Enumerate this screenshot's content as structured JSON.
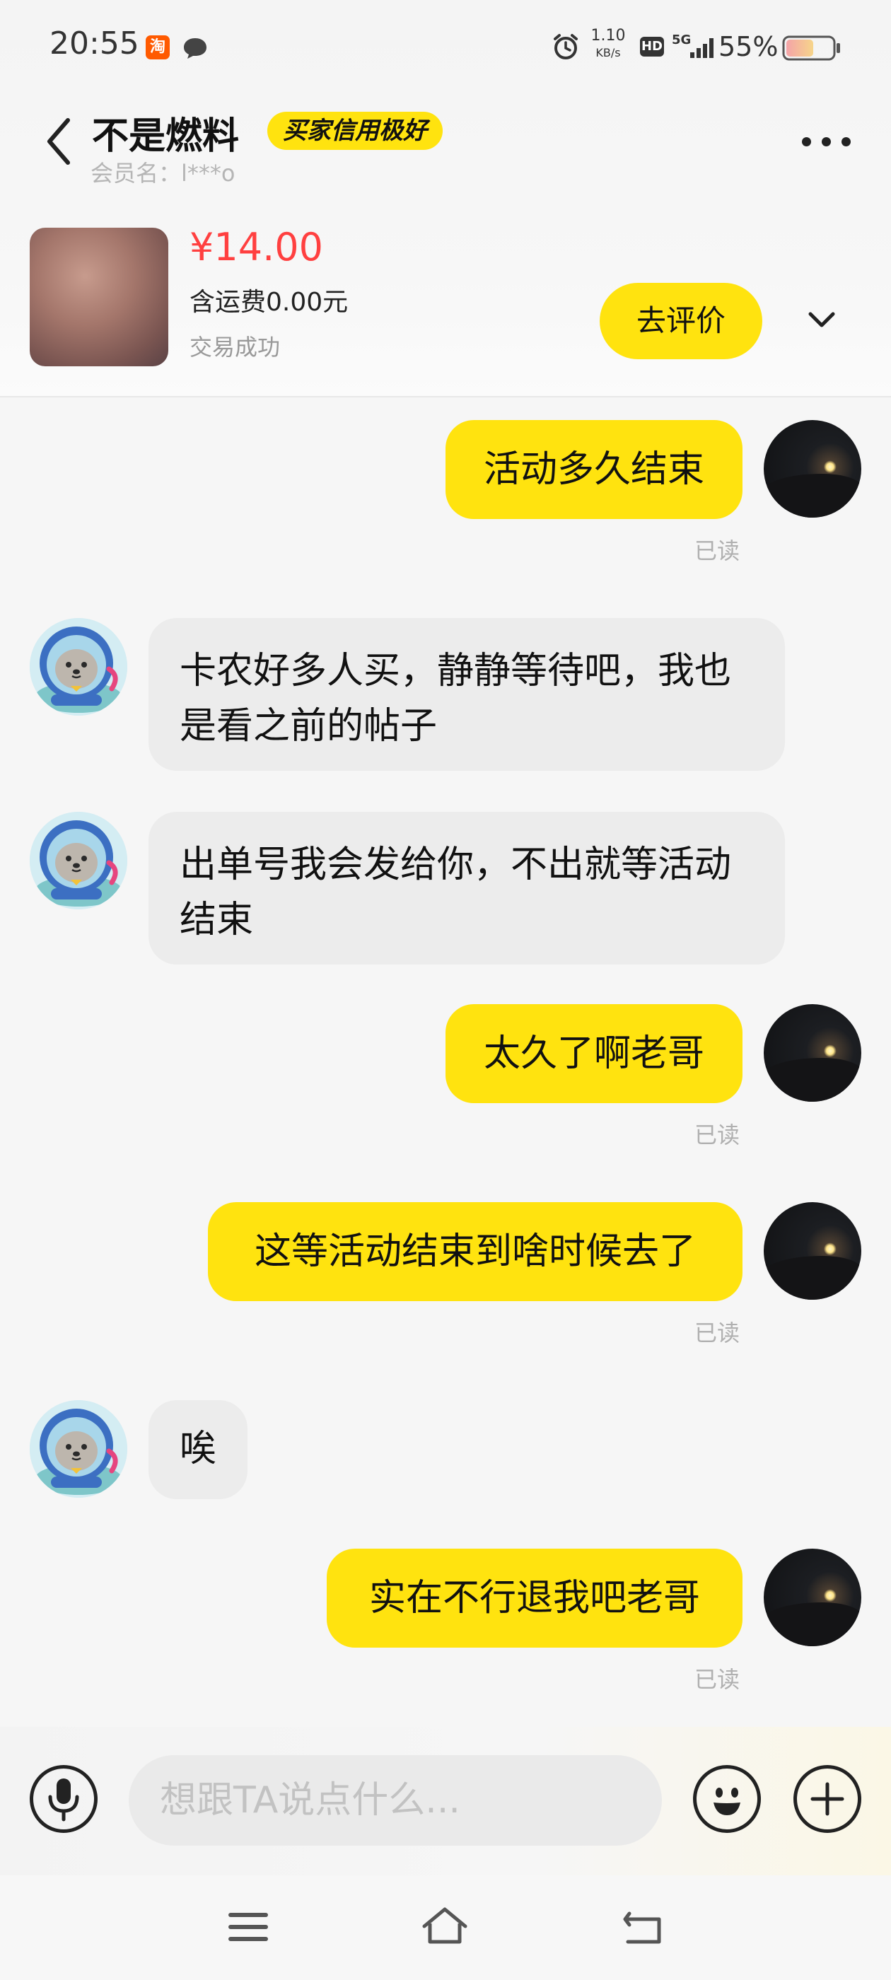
{
  "status_bar": {
    "time": "20:55",
    "taobao_badge": "淘",
    "net_speed_value": "1.10",
    "net_speed_unit": "KB/s",
    "hd": "HD",
    "network": "5G",
    "battery": "55%"
  },
  "header": {
    "title": "不是燃料",
    "credit_badge": "买家信用极好",
    "member": "会员名：l***o"
  },
  "product": {
    "price": "¥14.00",
    "shipping": "含运费0.00元",
    "status": "交易成功",
    "review_button": "去评价"
  },
  "messages": [
    {
      "side": "right",
      "text": "活动多久结束",
      "read": "已读"
    },
    {
      "side": "left",
      "text": "卡农好多人买，静静等待吧，我也是看之前的帖子"
    },
    {
      "side": "left",
      "text": "出单号我会发给你，不出就等活动结束"
    },
    {
      "side": "right",
      "text": "太久了啊老哥",
      "read": "已读"
    },
    {
      "side": "right",
      "text": "这等活动结束到啥时候去了",
      "read": "已读"
    },
    {
      "side": "left",
      "text": "唉"
    },
    {
      "side": "right",
      "text": "实在不行退我吧老哥",
      "read": "已读"
    }
  ],
  "input": {
    "placeholder": "想跟TA说点什么..."
  },
  "icons": {
    "back": "chevron-left-icon",
    "more": "more-icon",
    "expand": "chevron-down-icon",
    "voice": "microphone-icon",
    "emoji": "emoji-icon",
    "add": "plus-icon",
    "nav_menu": "menu-icon",
    "nav_home": "home-icon",
    "nav_back": "return-icon"
  },
  "colors": {
    "accent": "#ffe30f",
    "price": "#ff4040",
    "read": "#b0b0b0"
  }
}
